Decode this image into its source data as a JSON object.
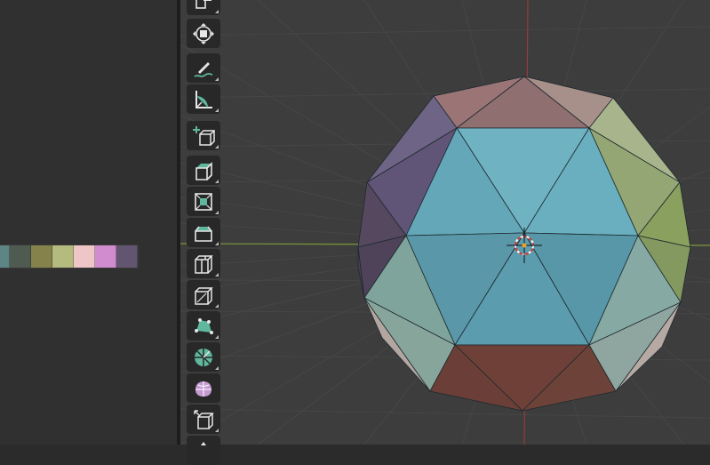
{
  "palette": {
    "swatches": [
      "#5e8585",
      "#4f5a50",
      "#85824b",
      "#b5ba7e",
      "#eec6c7",
      "#d18ccf",
      "#615570"
    ]
  },
  "toolbar": {
    "tools": [
      {
        "name": "scale-tool",
        "icon": "scale-icon"
      },
      {
        "name": "transform-tool",
        "icon": "transform-icon"
      },
      {
        "name": "annotate-tool",
        "icon": "annotate-icon"
      },
      {
        "name": "measure-tool",
        "icon": "measure-icon"
      },
      {
        "name": "add-cube-tool",
        "icon": "add-cube-icon"
      },
      {
        "name": "extrude-region-tool",
        "icon": "extrude-icon"
      },
      {
        "name": "inset-faces-tool",
        "icon": "inset-icon"
      },
      {
        "name": "bevel-tool",
        "icon": "bevel-icon"
      },
      {
        "name": "loop-cut-tool",
        "icon": "loop-cut-icon"
      },
      {
        "name": "knife-tool",
        "icon": "knife-icon"
      },
      {
        "name": "poly-build-tool",
        "icon": "poly-build-icon"
      },
      {
        "name": "spin-tool",
        "icon": "spin-icon"
      },
      {
        "name": "smooth-tool",
        "icon": "smooth-icon"
      },
      {
        "name": "edge-slide-tool",
        "icon": "edge-slide-icon"
      }
    ]
  },
  "viewport": {
    "object": "icosphere",
    "colors": {
      "grid": "#4a4a4a",
      "x_axis": "#7a9a3a",
      "y_axis": "#9a3a3a",
      "accent": "#5fb89e"
    }
  }
}
